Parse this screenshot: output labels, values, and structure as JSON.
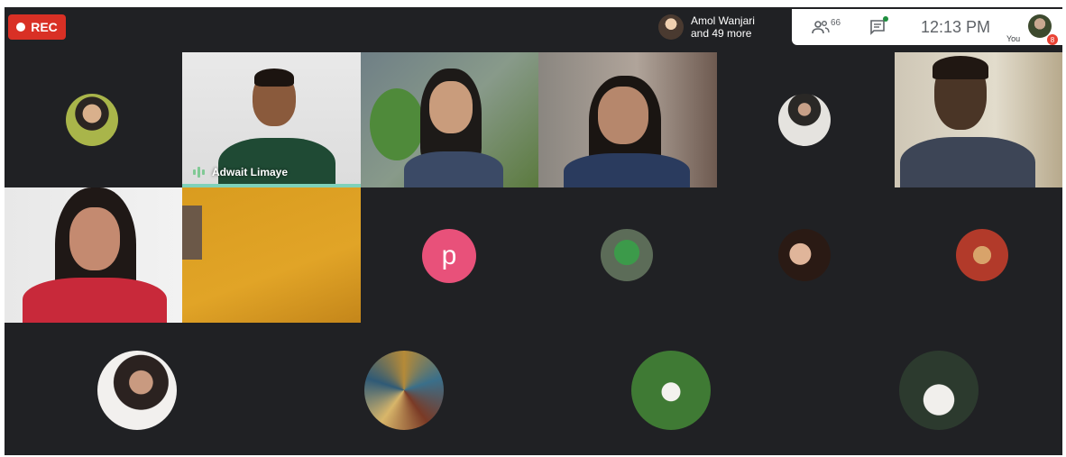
{
  "top_bar": {
    "rec_label": "REC",
    "presence_line1": "Amol Wanjari",
    "presence_line2": "and 49 more",
    "participants_count": "66",
    "time": "12:13 PM",
    "you_label": "You",
    "notification_count": "8"
  },
  "tiles": {
    "active_speaker_name": "Adwait Limaye",
    "initial_avatar_letter": "p"
  },
  "colors": {
    "background": "#202124",
    "rec": "#d93025",
    "initial_avatar": "#e8517a",
    "speaking": "#81c995"
  }
}
